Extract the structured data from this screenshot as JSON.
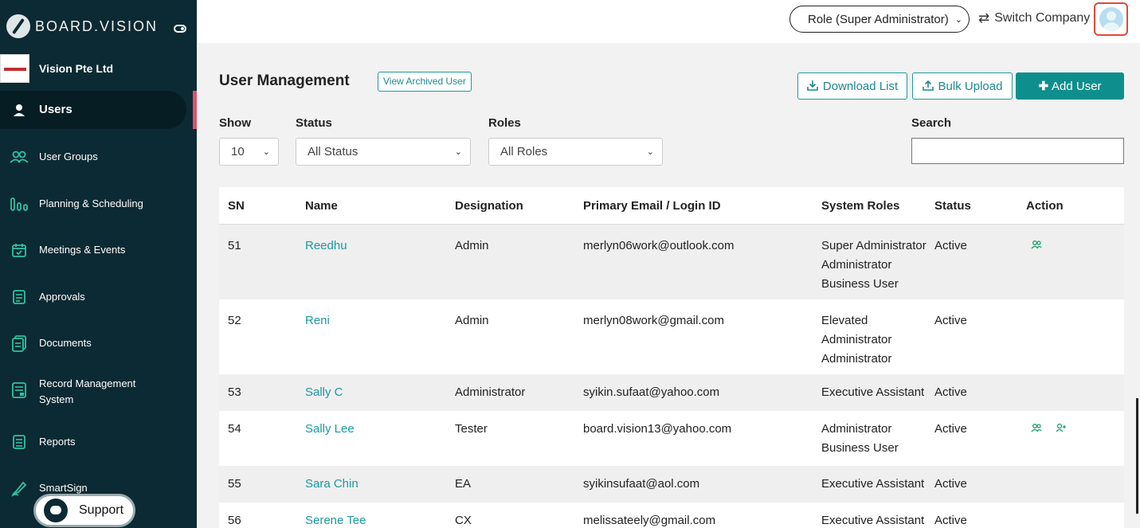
{
  "sidebar": {
    "brand": "BOARD.VISION",
    "company": "Vision Pte Ltd",
    "items": [
      {
        "label": "Users",
        "icon": "user-icon"
      },
      {
        "label": "User Groups",
        "icon": "user-group-icon"
      },
      {
        "label": "Planning & Scheduling",
        "icon": "planning-icon"
      },
      {
        "label": "Meetings & Events",
        "icon": "calendar-icon"
      },
      {
        "label": "Approvals",
        "icon": "approvals-icon"
      },
      {
        "label": "Documents",
        "icon": "documents-icon"
      },
      {
        "label": "Record Management",
        "label2": "System",
        "icon": "record-icon"
      },
      {
        "label": "Reports",
        "icon": "reports-icon"
      },
      {
        "label": "SmartSign",
        "icon": "smartsign-icon"
      }
    ],
    "support": "Support"
  },
  "topbar": {
    "role": "Role (Super Administrator)",
    "switch_company": "Switch Company"
  },
  "main": {
    "title": "User Management",
    "view_archived": "View Archived User",
    "download": "Download List",
    "bulk_upload": "Bulk Upload",
    "add_user": "Add User",
    "filters": {
      "show_label": "Show",
      "show_value": "10",
      "status_label": "Status",
      "status_value": "All Status",
      "roles_label": "Roles",
      "roles_value": "All Roles",
      "search_label": "Search",
      "search_value": ""
    }
  },
  "table": {
    "columns": [
      "SN",
      "Name",
      "Designation",
      "Primary Email / Login ID",
      "System Roles",
      "Status",
      "Action"
    ],
    "rows": [
      {
        "sn": "51",
        "name": "Reedhu",
        "designation": "Admin",
        "email": "merlyn06work@outlook.com",
        "roles": [
          "Super Administrator",
          "Administrator",
          "Business User"
        ],
        "status": "Active",
        "actions": [
          "manage-group-icon"
        ]
      },
      {
        "sn": "52",
        "name": "Reni",
        "designation": "Admin",
        "email": "merlyn08work@gmail.com",
        "roles": [
          "Elevated",
          "Administrator",
          "Administrator"
        ],
        "status": "Active",
        "actions": []
      },
      {
        "sn": "53",
        "name": "Sally C",
        "designation": "Administrator",
        "email": "syikin.sufaat@yahoo.com",
        "roles": [
          "Executive Assistant"
        ],
        "status": "Active",
        "actions": []
      },
      {
        "sn": "54",
        "name": "Sally Lee",
        "designation": "Tester",
        "email": "board.vision13@yahoo.com",
        "roles": [
          "Administrator",
          "Business User"
        ],
        "status": "Active",
        "actions": [
          "manage-group-icon",
          "add-user-icon"
        ]
      },
      {
        "sn": "55",
        "name": "Sara Chin",
        "designation": "EA",
        "email": "syikinsufaat@aol.com",
        "roles": [
          "Executive Assistant"
        ],
        "status": "Active",
        "actions": []
      },
      {
        "sn": "56",
        "name": "Serene Tee",
        "designation": "CX",
        "email": "melissateely@gmail.com",
        "roles": [
          "Executive Assistant"
        ],
        "status": "Active",
        "actions": []
      }
    ]
  },
  "colors": {
    "sidebar_bg": "#0c2a33",
    "accent": "#0f8e8e",
    "link": "#1a9aa0",
    "active_marker": "#e0506a"
  }
}
